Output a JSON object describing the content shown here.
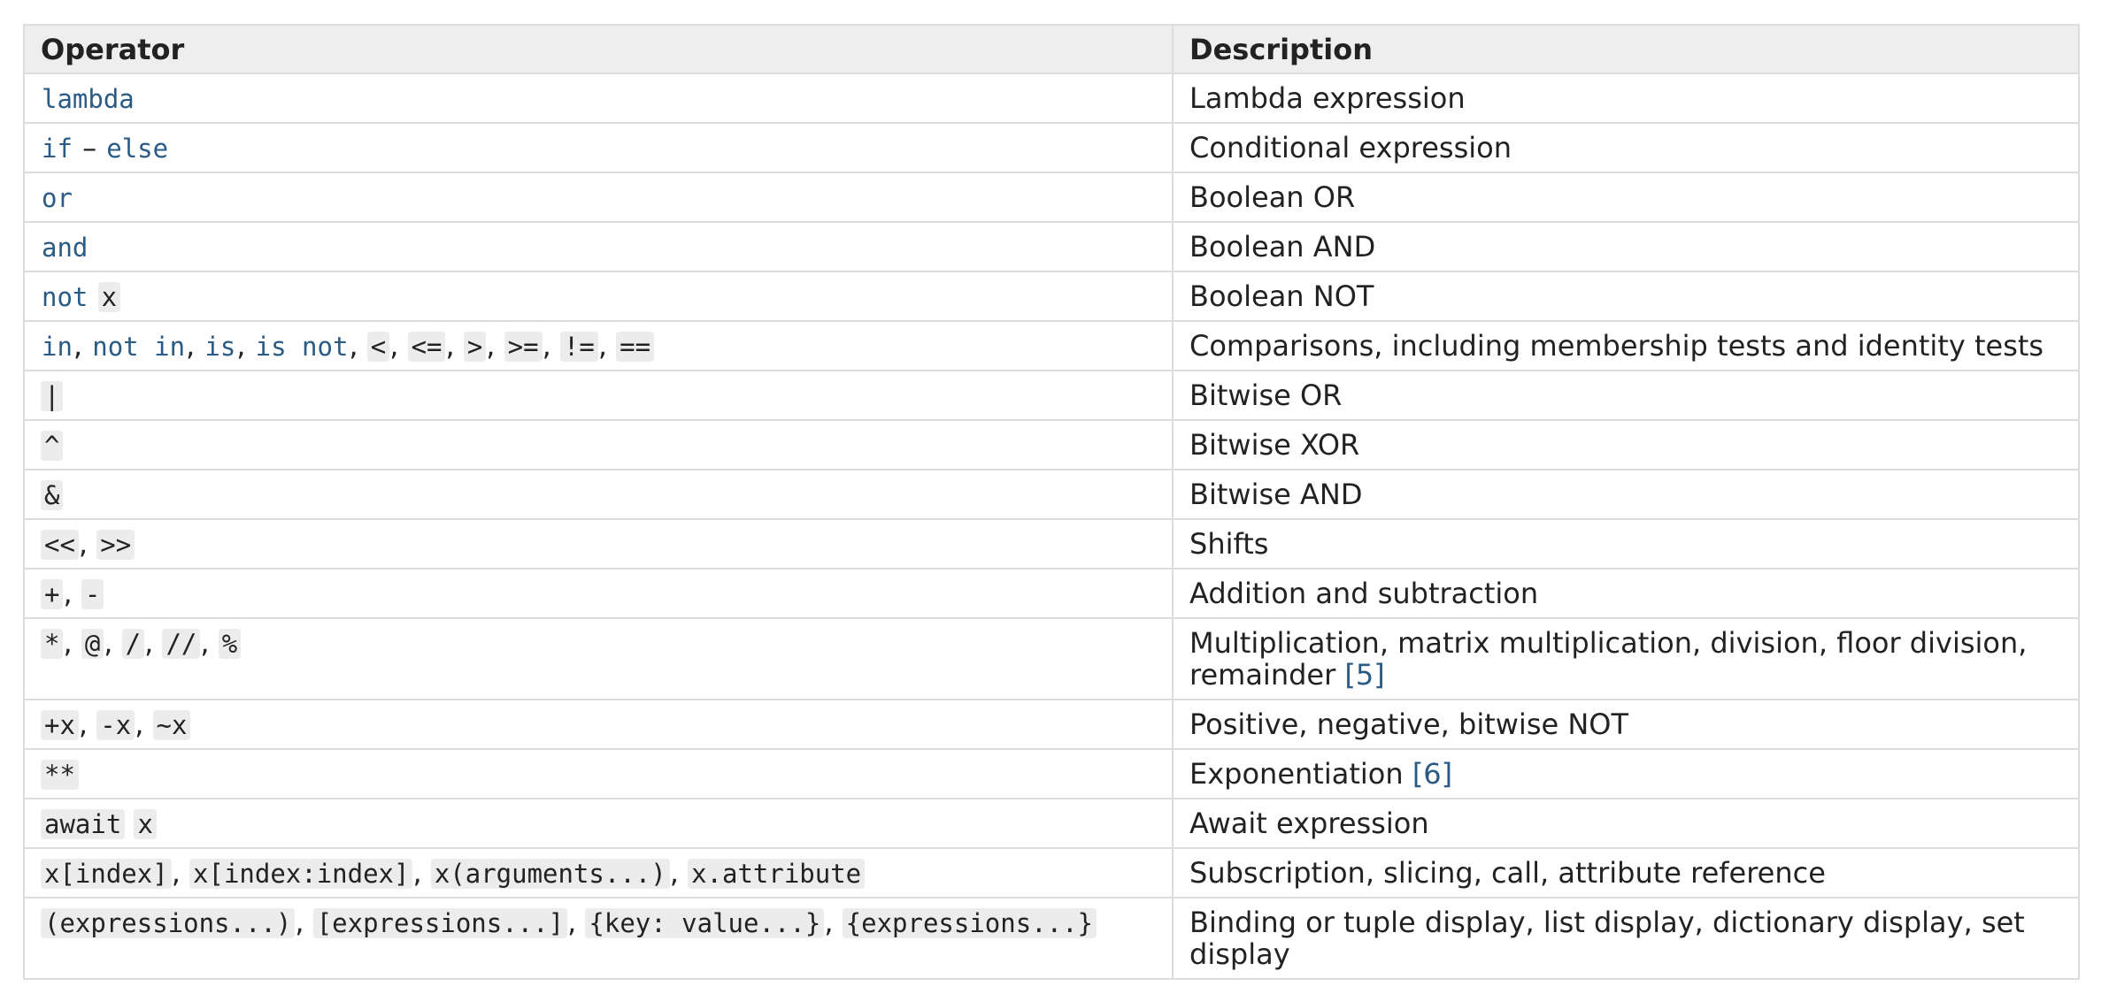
{
  "table": {
    "headers": [
      "Operator",
      "Description"
    ],
    "rows": [
      {
        "operator": [
          {
            "t": "lambda",
            "k": "kw"
          }
        ],
        "description": "Lambda expression",
        "ref": ""
      },
      {
        "operator": [
          {
            "t": "if",
            "k": "kw"
          },
          {
            "t": " – ",
            "k": "sep"
          },
          {
            "t": "else",
            "k": "kw"
          }
        ],
        "description": "Conditional expression",
        "ref": ""
      },
      {
        "operator": [
          {
            "t": "or",
            "k": "kw"
          }
        ],
        "description": "Boolean OR",
        "ref": ""
      },
      {
        "operator": [
          {
            "t": "and",
            "k": "kw"
          }
        ],
        "description": "Boolean AND",
        "ref": ""
      },
      {
        "operator": [
          {
            "t": "not",
            "k": "kw"
          },
          {
            "t": " ",
            "k": "sep"
          },
          {
            "t": "x",
            "k": "code"
          }
        ],
        "description": "Boolean NOT",
        "ref": ""
      },
      {
        "operator": [
          {
            "t": "in",
            "k": "kw"
          },
          {
            "t": ", ",
            "k": "sep"
          },
          {
            "t": "not in",
            "k": "kw"
          },
          {
            "t": ", ",
            "k": "sep"
          },
          {
            "t": "is",
            "k": "kw"
          },
          {
            "t": ", ",
            "k": "sep"
          },
          {
            "t": "is not",
            "k": "kw"
          },
          {
            "t": ", ",
            "k": "sep"
          },
          {
            "t": "<",
            "k": "code"
          },
          {
            "t": ", ",
            "k": "sep"
          },
          {
            "t": "<=",
            "k": "code"
          },
          {
            "t": ", ",
            "k": "sep"
          },
          {
            "t": ">",
            "k": "code"
          },
          {
            "t": ", ",
            "k": "sep"
          },
          {
            "t": ">=",
            "k": "code"
          },
          {
            "t": ", ",
            "k": "sep"
          },
          {
            "t": "!=",
            "k": "code"
          },
          {
            "t": ", ",
            "k": "sep"
          },
          {
            "t": "==",
            "k": "code"
          }
        ],
        "description": "Comparisons, including membership tests and identity tests",
        "ref": ""
      },
      {
        "operator": [
          {
            "t": "|",
            "k": "code"
          }
        ],
        "description": "Bitwise OR",
        "ref": ""
      },
      {
        "operator": [
          {
            "t": "^",
            "k": "code"
          }
        ],
        "description": "Bitwise XOR",
        "ref": ""
      },
      {
        "operator": [
          {
            "t": "&",
            "k": "code"
          }
        ],
        "description": "Bitwise AND",
        "ref": ""
      },
      {
        "operator": [
          {
            "t": "<<",
            "k": "code"
          },
          {
            "t": ", ",
            "k": "sep"
          },
          {
            "t": ">>",
            "k": "code"
          }
        ],
        "description": "Shifts",
        "ref": ""
      },
      {
        "operator": [
          {
            "t": "+",
            "k": "code"
          },
          {
            "t": ", ",
            "k": "sep"
          },
          {
            "t": "-",
            "k": "code"
          }
        ],
        "description": "Addition and subtraction",
        "ref": ""
      },
      {
        "operator": [
          {
            "t": "*",
            "k": "code"
          },
          {
            "t": ", ",
            "k": "sep"
          },
          {
            "t": "@",
            "k": "code"
          },
          {
            "t": ", ",
            "k": "sep"
          },
          {
            "t": "/",
            "k": "code"
          },
          {
            "t": ", ",
            "k": "sep"
          },
          {
            "t": "//",
            "k": "code"
          },
          {
            "t": ", ",
            "k": "sep"
          },
          {
            "t": "%",
            "k": "code"
          }
        ],
        "description": "Multiplication, matrix multiplication, division, floor division, remainder",
        "ref": "[5]"
      },
      {
        "operator": [
          {
            "t": "+x",
            "k": "code"
          },
          {
            "t": ", ",
            "k": "sep"
          },
          {
            "t": "-x",
            "k": "code"
          },
          {
            "t": ", ",
            "k": "sep"
          },
          {
            "t": "~x",
            "k": "code"
          }
        ],
        "description": "Positive, negative, bitwise NOT",
        "ref": ""
      },
      {
        "operator": [
          {
            "t": "**",
            "k": "code"
          }
        ],
        "description": "Exponentiation",
        "ref": "[6]"
      },
      {
        "operator": [
          {
            "t": "await",
            "k": "code"
          },
          {
            "t": " ",
            "k": "sep"
          },
          {
            "t": "x",
            "k": "code"
          }
        ],
        "description": "Await expression",
        "ref": ""
      },
      {
        "operator": [
          {
            "t": "x[index]",
            "k": "code"
          },
          {
            "t": ", ",
            "k": "sep"
          },
          {
            "t": "x[index:index]",
            "k": "code"
          },
          {
            "t": ", ",
            "k": "sep"
          },
          {
            "t": "x(arguments...)",
            "k": "code"
          },
          {
            "t": ", ",
            "k": "sep"
          },
          {
            "t": "x.attribute",
            "k": "code"
          }
        ],
        "description": "Subscription, slicing, call, attribute reference",
        "ref": ""
      },
      {
        "operator": [
          {
            "t": "(expressions...)",
            "k": "code"
          },
          {
            "t": ", ",
            "k": "sep"
          },
          {
            "t": "[expressions...]",
            "k": "code"
          },
          {
            "t": ", ",
            "k": "sep"
          },
          {
            "t": "{key: value...}",
            "k": "code"
          },
          {
            "t": ", ",
            "k": "sep"
          },
          {
            "t": "{expressions...}",
            "k": "code"
          }
        ],
        "description": "Binding or tuple display, list display, dictionary display, set display",
        "ref": ""
      }
    ]
  }
}
